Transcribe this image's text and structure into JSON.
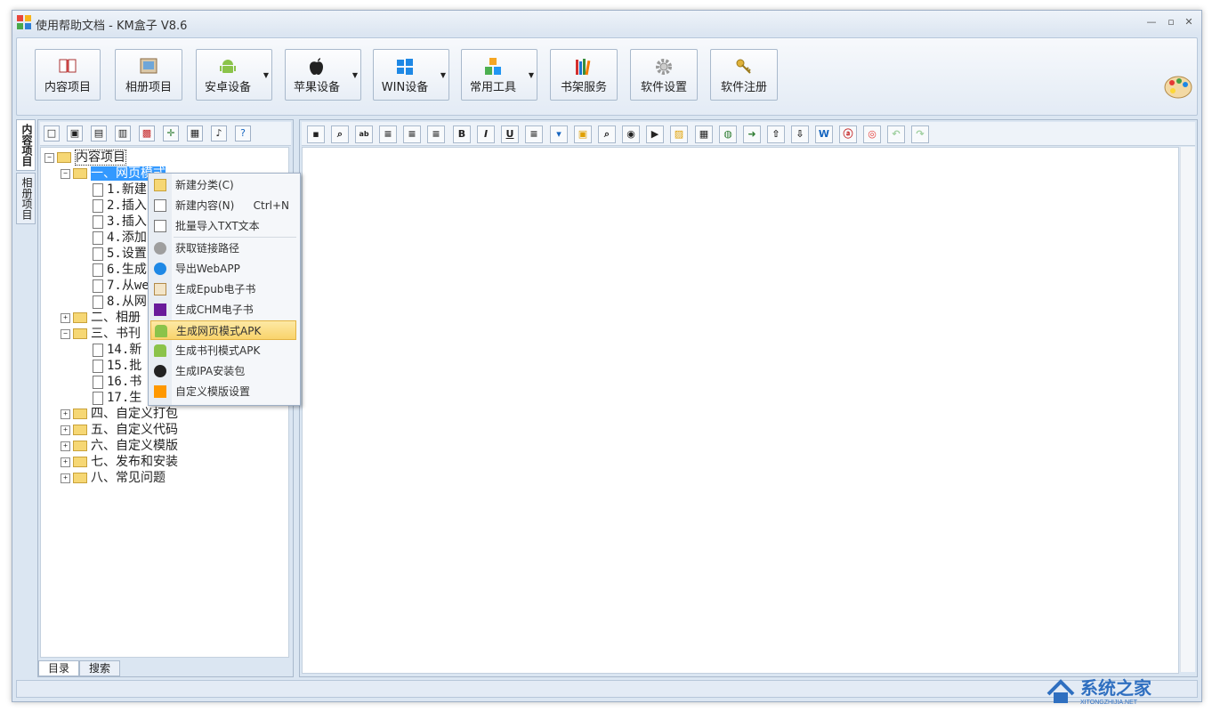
{
  "window": {
    "title": "使用帮助文档 - KM盒子 V8.6"
  },
  "toolbar": {
    "buttons": [
      {
        "label": "内容项目",
        "icon": "book-icon"
      },
      {
        "label": "相册项目",
        "icon": "photo-album-icon"
      },
      {
        "label": "安卓设备",
        "icon": "android-icon"
      },
      {
        "label": "苹果设备",
        "icon": "apple-icon"
      },
      {
        "label": "WIN设备",
        "icon": "windows-icon"
      },
      {
        "label": "常用工具",
        "icon": "tools-blocks-icon"
      },
      {
        "label": "书架服务",
        "icon": "bookshelf-icon"
      },
      {
        "label": "软件设置",
        "icon": "gear-icon"
      },
      {
        "label": "软件注册",
        "icon": "key-icon"
      }
    ]
  },
  "sidetabs": [
    "内容项目",
    "相册项目"
  ],
  "tree": {
    "root": "内容项目",
    "nodes": [
      "一、网页模式",
      "1.新建",
      "2.插入",
      "3.插入",
      "4.添加",
      "5.设置",
      "6.生成",
      "7.从we",
      "8.从网",
      "二、相册",
      "三、书刊",
      "14.新",
      "15.批",
      "16.书",
      "17.生",
      "四、自定义打包",
      "五、自定义代码",
      "六、自定义模版",
      "七、发布和安装",
      "八、常见问题"
    ]
  },
  "bottom_tabs": [
    "目录",
    "搜索"
  ],
  "context_menu": {
    "items": [
      {
        "label": "新建分类(C)",
        "shortcut": ""
      },
      {
        "label": "新建内容(N)",
        "shortcut": "Ctrl+N"
      },
      {
        "label": "批量导入TXT文本",
        "shortcut": ""
      },
      {
        "label": "获取链接路径",
        "shortcut": ""
      },
      {
        "label": "导出WebAPP",
        "shortcut": ""
      },
      {
        "label": "生成Epub电子书",
        "shortcut": ""
      },
      {
        "label": "生成CHM电子书",
        "shortcut": ""
      },
      {
        "label": "生成网页模式APK",
        "shortcut": ""
      },
      {
        "label": "生成书刊模式APK",
        "shortcut": ""
      },
      {
        "label": "生成IPA安装包",
        "shortcut": ""
      },
      {
        "label": "自定义模版设置",
        "shortcut": ""
      }
    ],
    "highlighted": "生成网页模式APK"
  },
  "watermark": {
    "text": "系统之家",
    "sub": "XITONGZHIJIA.NET"
  },
  "colors": {
    "accent": "#3399ff",
    "highlight": "#f9d36b",
    "frame": "#dbe6f2"
  }
}
